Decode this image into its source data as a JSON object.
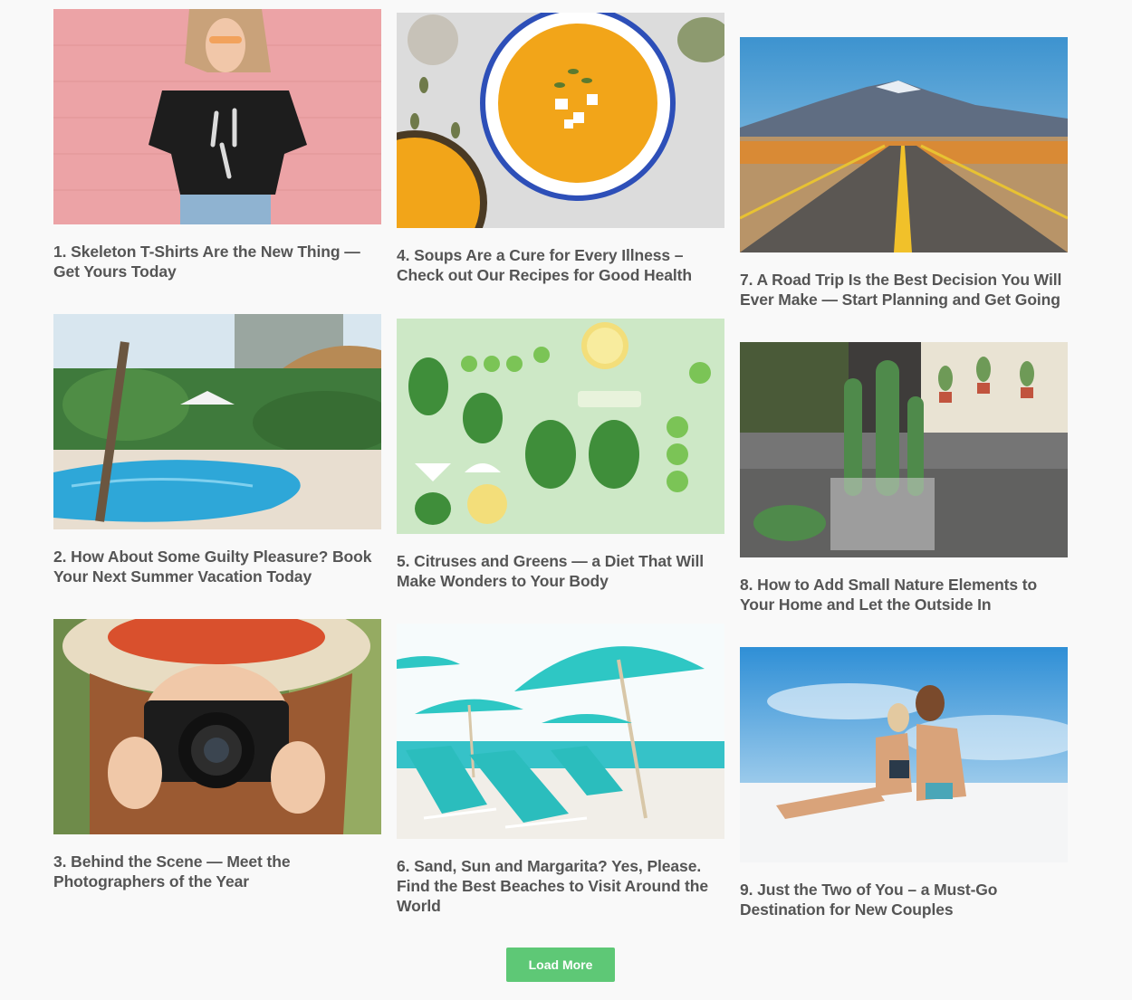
{
  "posts": [
    {
      "title": "1. Skeleton T-Shirts Are the New Thing — Get Yours Today",
      "image": "woman-skeleton-tshirt-pink-wall"
    },
    {
      "title": "2. How About Some Guilty Pleasure? Book Your Next Summer Vacation Today",
      "image": "resort-swimming-pool"
    },
    {
      "title": "3. Behind the Scene — Meet the Photographers of the Year",
      "image": "woman-with-camera-red-hat"
    },
    {
      "title": "4. Soups Are a Cure for Every Illness – Check out Our Recipes for Good Health",
      "image": "pumpkin-soup-bowl"
    },
    {
      "title": "5. Citruses and Greens — a Diet That Will Make Wonders to Your Body",
      "image": "greens-and-citrus-flatlay"
    },
    {
      "title": "6. Sand, Sun and Margarita? Yes, Please. Find the Best Beaches to Visit Around the World",
      "image": "beach-umbrellas-loungers"
    },
    {
      "title": "7. A Road Trip Is the Best Decision You Will Ever Make — Start Planning and Get Going",
      "image": "desert-road-mountain"
    },
    {
      "title": "8. How to Add Small Nature Elements to Your Home and Let the Outside In",
      "image": "cactus-on-sofa"
    },
    {
      "title": "9. Just the Two of You – a Must-Go Destination for New Couples",
      "image": "couple-on-beach"
    }
  ],
  "load_more_label": "Load More",
  "colors": {
    "background": "#f9f9f9",
    "title_text": "#555555",
    "button": "#5ec876",
    "button_text": "#ffffff"
  }
}
